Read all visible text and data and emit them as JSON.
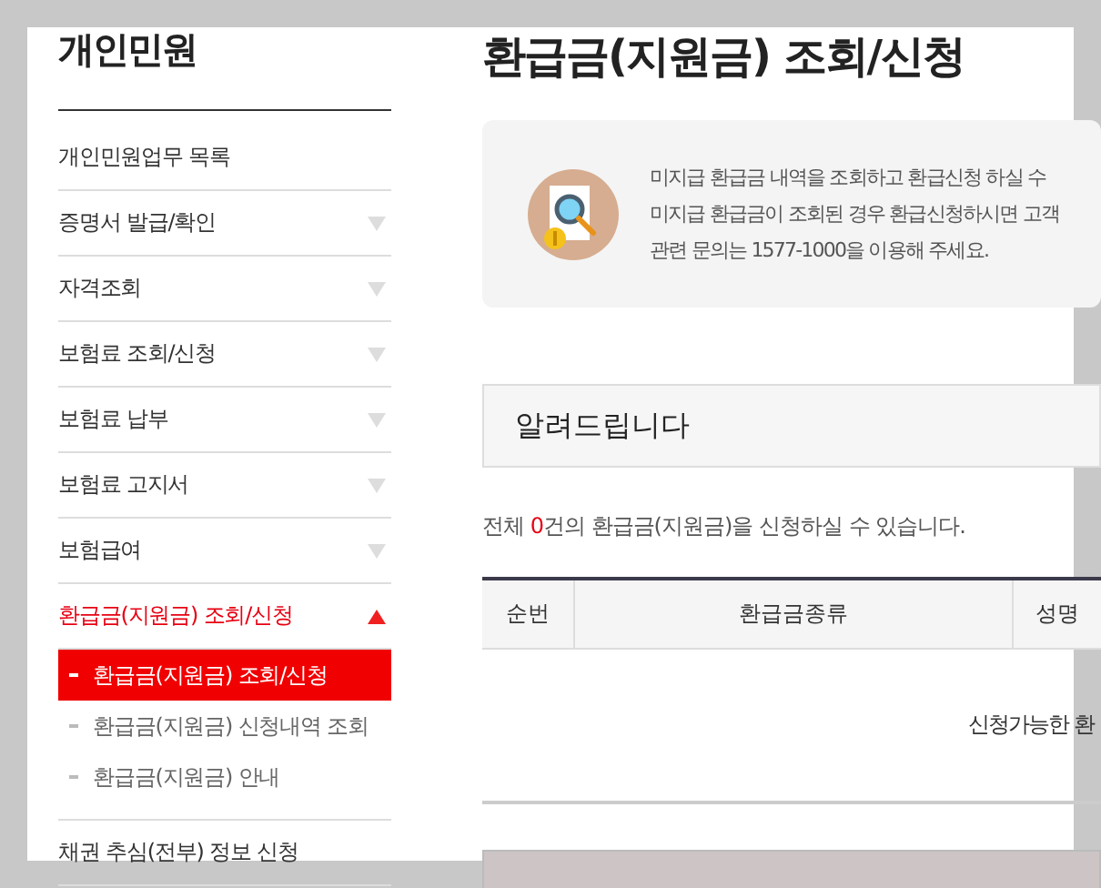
{
  "sidebar": {
    "title": "개인민원",
    "items": [
      {
        "label": "개인민원업무 목록",
        "kind": "link"
      },
      {
        "label": "증명서 발급/확인",
        "kind": "menu",
        "expanded": false
      },
      {
        "label": "자격조회",
        "kind": "menu",
        "expanded": false
      },
      {
        "label": "보험료 조회/신청",
        "kind": "menu",
        "expanded": false
      },
      {
        "label": "보험료 납부",
        "kind": "menu",
        "expanded": false
      },
      {
        "label": "보험료 고지서",
        "kind": "menu",
        "expanded": false
      },
      {
        "label": "보험급여",
        "kind": "menu",
        "expanded": false
      },
      {
        "label": "환급금(지원금) 조회/신청",
        "kind": "menu",
        "expanded": true,
        "children": [
          {
            "label": "환급금(지원금) 조회/신청",
            "selected": true
          },
          {
            "label": "환급금(지원금) 신청내역 조회",
            "selected": false
          },
          {
            "label": "환급금(지원금) 안내",
            "selected": false
          }
        ]
      },
      {
        "label": "채권 추심(전부) 정보 신청",
        "kind": "link"
      }
    ]
  },
  "page": {
    "title": "환급금(지원금) 조회/신청",
    "info": [
      "미지급 환급금 내역을 조회하고 환급신청 하실 수",
      "미지급 환급금이 조회된 경우 환급신청하시면 고객",
      "관련 문의는 1577-1000을 이용해 주세요."
    ],
    "notice_title": "알려드립니다",
    "count_text": {
      "prefix": "전체 ",
      "count": "0",
      "suffix": "건의 환급금(지원금)을 신청하실 수 있습니다."
    },
    "table": {
      "columns": [
        "순번",
        "환급금종류",
        "성명"
      ],
      "empty_message": "신청가능한 환"
    }
  }
}
